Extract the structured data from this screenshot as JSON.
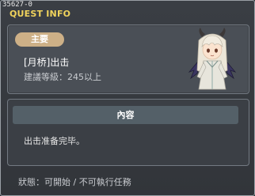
{
  "window": {
    "quest_id": "35627-0",
    "title": "QUEST INFO"
  },
  "summary": {
    "badge_label": "主要",
    "quest_name": "[月桥]出击",
    "recommended_level": "建議等級：245以上",
    "npc_icon": "npc-portrait-icon"
  },
  "content": {
    "header_label": "內容",
    "text": "出击准备完毕。"
  },
  "status": {
    "text": "狀態：可開始 / 不可執行任務"
  },
  "colors": {
    "title": "#f0d35c",
    "badge": "#cdb087",
    "header": "#546068",
    "panel": "#4a4f56"
  }
}
